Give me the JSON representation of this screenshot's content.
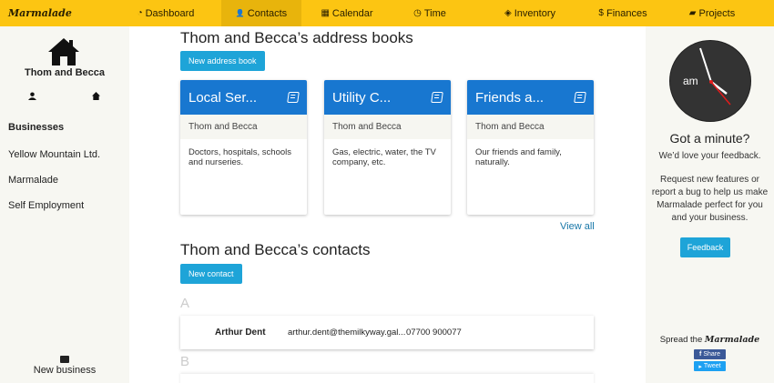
{
  "app": {
    "logo": "Marmalade"
  },
  "nav": [
    {
      "label": "Dashboard",
      "icon": "dashboard-icon",
      "glyph": "◔"
    },
    {
      "label": "Contacts",
      "icon": "user-icon",
      "glyph": "👤"
    },
    {
      "label": "Calendar",
      "icon": "calendar-icon",
      "glyph": "▦"
    },
    {
      "label": "Time",
      "icon": "clock-icon",
      "glyph": "◷"
    },
    {
      "label": "Inventory",
      "icon": "cube-icon",
      "glyph": "◈"
    },
    {
      "label": "Finances",
      "icon": "dollar-icon",
      "glyph": "$"
    },
    {
      "label": "Projects",
      "icon": "folder-icon",
      "glyph": "▰"
    }
  ],
  "active_nav": "Contacts",
  "sidebar": {
    "account_name": "Thom and Becca",
    "section_title": "Businesses",
    "businesses": [
      "Yellow Mountain Ltd.",
      "Marmalade",
      "Self Employment"
    ],
    "new_business_label": "New business"
  },
  "main": {
    "address_books_title": "Thom and Becca’s address books",
    "new_address_book_label": "New address book",
    "address_books": [
      {
        "name": "Local Ser...",
        "owner": "Thom and Becca",
        "description": "Doctors, hospitals, schools and nurseries."
      },
      {
        "name": "Utility C...",
        "owner": "Thom and Becca",
        "description": "Gas, electric, water, the TV company, etc."
      },
      {
        "name": "Friends a...",
        "owner": "Thom and Becca",
        "description": "Our friends and family, naturally."
      }
    ],
    "view_all_label": "View all",
    "contacts_title": "Thom and Becca’s contacts",
    "new_contact_label": "New contact",
    "groups": [
      {
        "letter": "A",
        "contacts": [
          {
            "name": "Arthur Dent",
            "email": "arthur.dent@themilkyway.gal...",
            "phone": "07700 900077"
          }
        ]
      },
      {
        "letter": "B",
        "contacts": []
      }
    ]
  },
  "right": {
    "clock_period": "am",
    "title": "Got a minute?",
    "subtitle": "We’d love your feedback.",
    "body": "Request new features or report a bug to help us make Marmalade perfect for you and your business.",
    "feedback_label": "Feedback",
    "spread_prefix": "Spread the",
    "spread_brand": "Marmalade",
    "share_label": "Share",
    "tweet_label": "Tweet"
  },
  "colors": {
    "brand": "#fcc512",
    "accent": "#1ea4d8",
    "card_header": "#1877d0"
  }
}
